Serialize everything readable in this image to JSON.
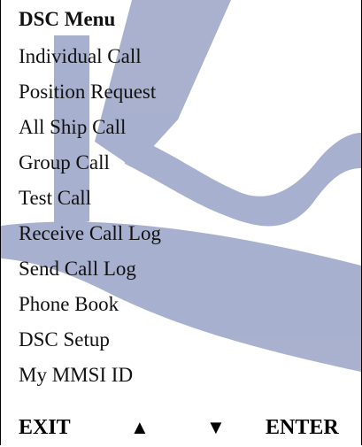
{
  "menu": {
    "title": "DSC Menu",
    "items": [
      "Individual Call",
      "Position Request",
      "All Ship Call",
      "Group Call",
      "Test Call",
      "Receive Call Log",
      "Send Call Log",
      "Phone Book",
      "DSC Setup",
      "My MMSI ID"
    ]
  },
  "softkeys": {
    "exit": "EXIT",
    "up": "▲",
    "down": "▼",
    "enter": "ENTER"
  },
  "colors": {
    "watermark": "#9aa3c7",
    "background": "#ffffff",
    "text": "#111111"
  }
}
